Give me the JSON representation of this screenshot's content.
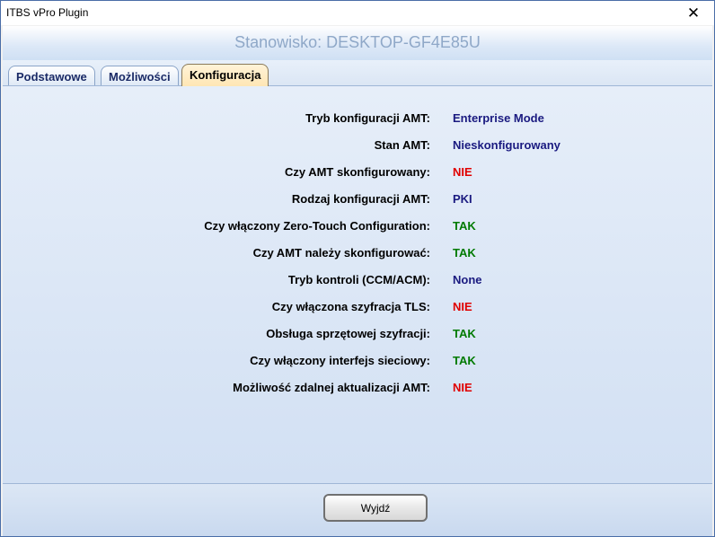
{
  "window": {
    "title": "ITBS vPro Plugin",
    "close_glyph": "✕"
  },
  "header": {
    "station": "Stanowisko: DESKTOP-GF4E85U"
  },
  "tabs": [
    {
      "label": "Podstawowe"
    },
    {
      "label": "Możliwości"
    },
    {
      "label": "Konfiguracja",
      "active": true
    }
  ],
  "colors": {
    "ok": "#007a00",
    "no": "#e00000",
    "info": "#1a1a80"
  },
  "rows": [
    {
      "label": "Tryb konfiguracji AMT:",
      "value": "Enterprise Mode",
      "status": "info"
    },
    {
      "label": "Stan AMT:",
      "value": "Nieskonfigurowany",
      "status": "info"
    },
    {
      "label": "Czy AMT skonfigurowany:",
      "value": "NIE",
      "status": "no"
    },
    {
      "label": "Rodzaj konfiguracji AMT:",
      "value": "PKI",
      "status": "info"
    },
    {
      "label": "Czy włączony Zero-Touch Configuration:",
      "value": "TAK",
      "status": "ok"
    },
    {
      "label": "Czy AMT należy skonfigurować:",
      "value": "TAK",
      "status": "ok"
    },
    {
      "label": "Tryb kontroli (CCM/ACM):",
      "value": "None",
      "status": "info"
    },
    {
      "label": "Czy włączona szyfracja TLS:",
      "value": "NIE",
      "status": "no"
    },
    {
      "label": "Obsługa sprzętowej szyfracji:",
      "value": "TAK",
      "status": "ok"
    },
    {
      "label": "Czy włączony interfejs sieciowy:",
      "value": "TAK",
      "status": "ok"
    },
    {
      "label": "Możliwość zdalnej aktualizacji AMT:",
      "value": "NIE",
      "status": "no"
    }
  ],
  "footer": {
    "exit_label": "Wyjdź"
  }
}
